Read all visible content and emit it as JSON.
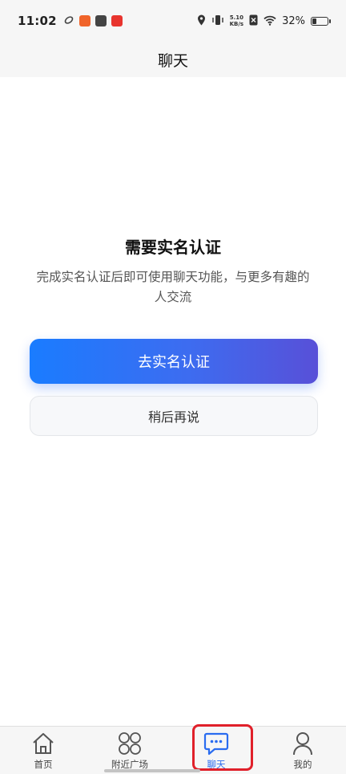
{
  "status_bar": {
    "time": "11:02",
    "net_speed_value": "5.10",
    "net_speed_unit": "KB/s",
    "battery_percent": "32%",
    "battery_level": 0.32
  },
  "header": {
    "title": "聊天"
  },
  "verification": {
    "title": "需要实名认证",
    "description": "完成实名认证后即可使用聊天功能，与更多有趣的人交流",
    "primary_button": "去实名认证",
    "secondary_button": "稍后再说"
  },
  "bottom_nav": {
    "items": [
      {
        "label": "首页",
        "icon": "home-icon"
      },
      {
        "label": "附近广场",
        "icon": "grid-circles-icon"
      },
      {
        "label": "聊天",
        "icon": "chat-bubble-icon",
        "active": true
      },
      {
        "label": "我的",
        "icon": "person-icon"
      }
    ]
  },
  "colors": {
    "accent": "#2a6cf0",
    "button_gradient_start": "#1a7cff",
    "button_gradient_end": "#5850d8",
    "highlight": "#e0202a"
  }
}
